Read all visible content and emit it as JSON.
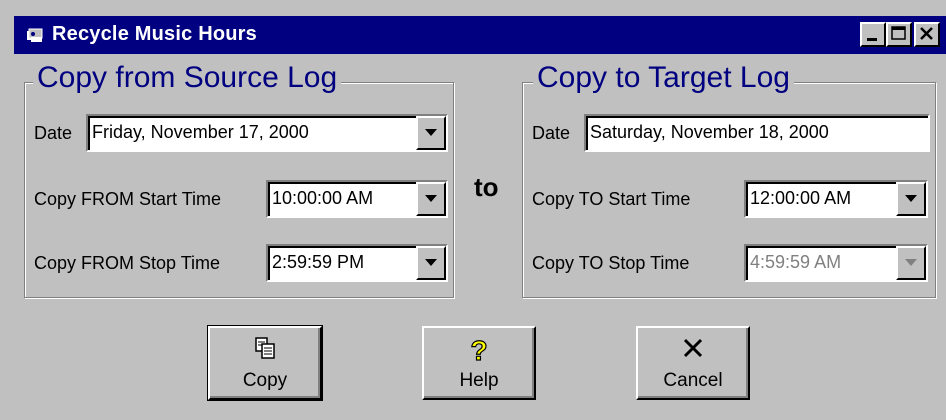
{
  "window": {
    "title": "Recycle Music Hours",
    "icon": "app-icon",
    "controls": [
      "minimize-icon",
      "maximize-icon",
      "close-icon"
    ]
  },
  "source": {
    "heading": "Copy from Source Log",
    "date_label": "Date",
    "date_value": "Friday, November 17, 2000",
    "start_label": "Copy FROM Start Time",
    "start_value": "10:00:00 AM",
    "stop_label": "Copy FROM Stop Time",
    "stop_value": "2:59:59 PM"
  },
  "connector": "to",
  "target": {
    "heading": "Copy to Target Log",
    "date_label": "Date",
    "date_value": "Saturday, November 18, 2000",
    "start_label": "Copy TO Start Time",
    "start_value": "12:00:00 AM",
    "stop_label": "Copy TO Stop Time",
    "stop_value": "4:59:59 AM"
  },
  "buttons": {
    "copy": "Copy",
    "help": "Help",
    "cancel": "Cancel"
  },
  "colors": {
    "titlebar": "#000080",
    "face": "#c0c0c0",
    "heading": "#000080",
    "disabled_text": "#808080"
  }
}
